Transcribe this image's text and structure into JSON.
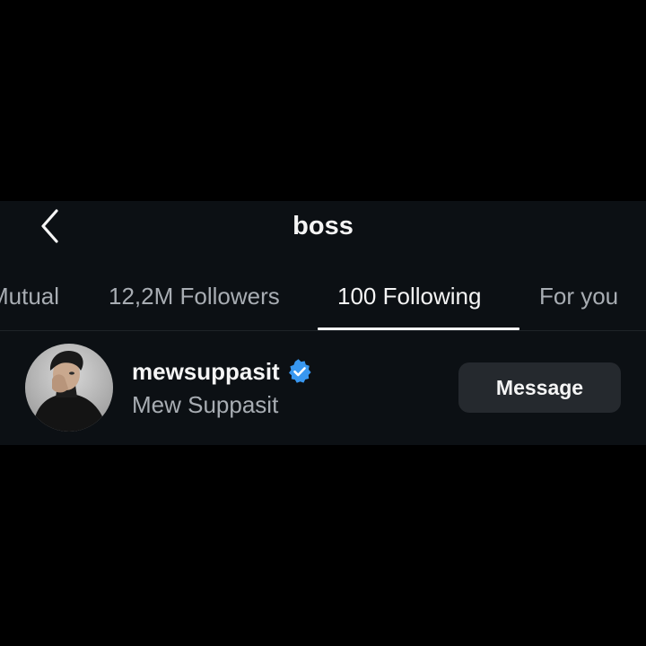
{
  "header": {
    "title": "boss",
    "back_icon": "chevron-left-icon"
  },
  "tabs": [
    {
      "label": "Mutual",
      "active": false
    },
    {
      "label": "12,2M Followers",
      "active": false
    },
    {
      "label": "100 Following",
      "active": true
    },
    {
      "label": "For you",
      "active": false
    }
  ],
  "list": [
    {
      "username": "mewsuppasit",
      "full_name": "Mew Suppasit",
      "verified": true,
      "verified_icon": "verified-badge-icon",
      "action_label": "Message"
    }
  ],
  "colors": {
    "background": "#000000",
    "panel": "#0c1014",
    "primary_text": "#f5f5f5",
    "secondary_text": "#a8adb3",
    "button": "#25292e",
    "verified": "#3897f0"
  }
}
